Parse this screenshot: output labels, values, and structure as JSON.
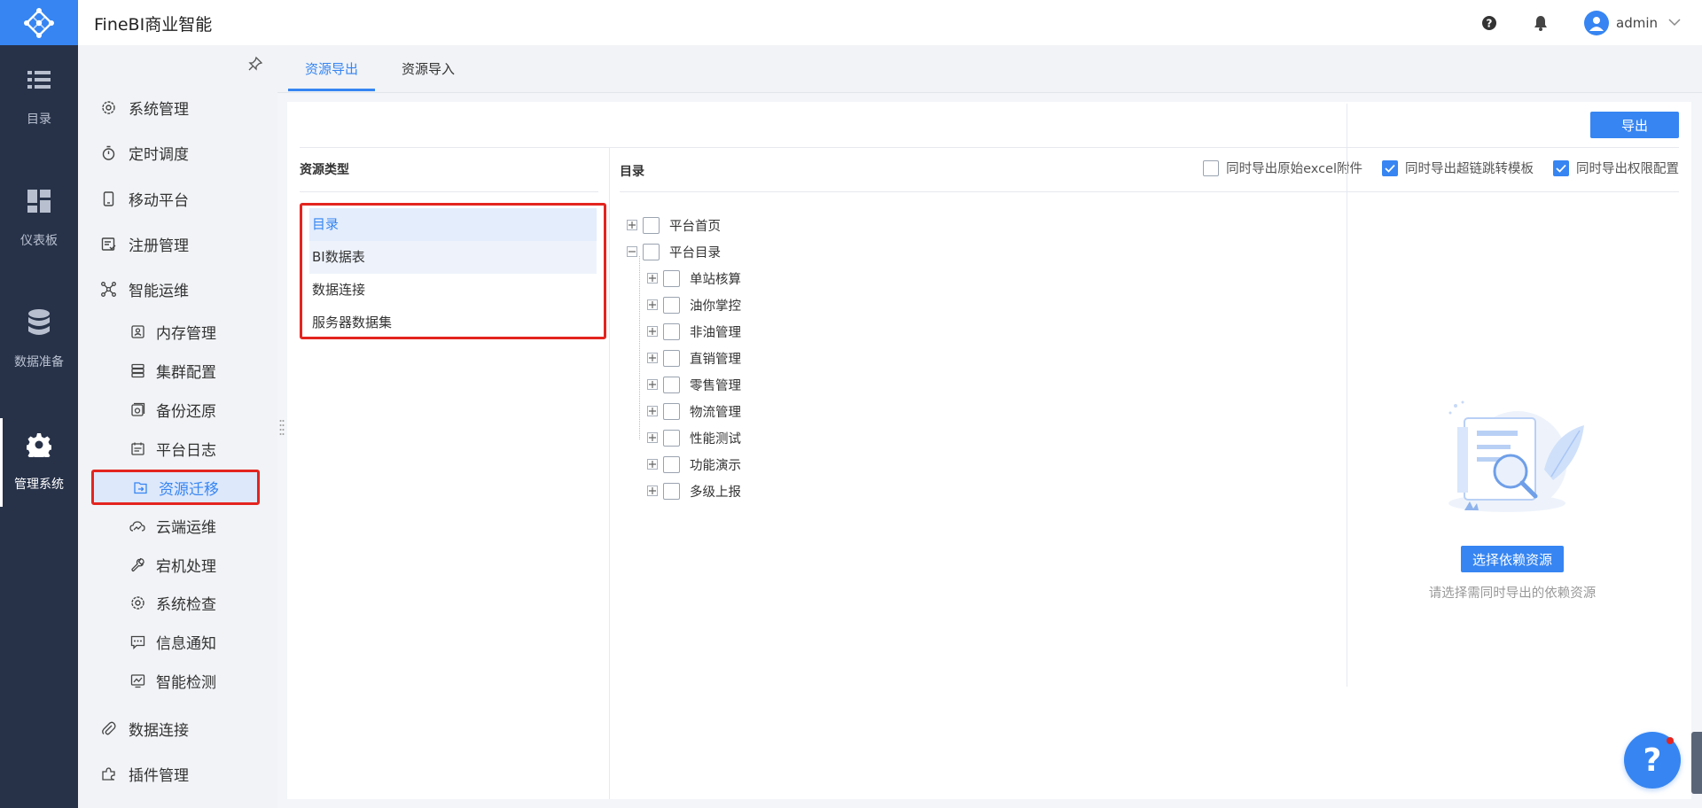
{
  "app": {
    "title": "FineBI商业智能",
    "user": "admin"
  },
  "colors": {
    "accent": "#3685f2",
    "rail_bg": "#273249",
    "highlight_border": "#e4241f"
  },
  "rail": {
    "logo_icon": "finebi-logo-icon",
    "items": [
      {
        "label": "目录",
        "icon": "list-icon"
      },
      {
        "label": "仪表板",
        "icon": "dashboard-icon"
      },
      {
        "label": "数据准备",
        "icon": "database-icon"
      },
      {
        "label": "管理系统",
        "icon": "gear-icon"
      }
    ]
  },
  "menu": {
    "items": [
      {
        "label": "系统管理",
        "icon": "settings-icon"
      },
      {
        "label": "定时调度",
        "icon": "timer-icon"
      },
      {
        "label": "移动平台",
        "icon": "mobile-icon"
      },
      {
        "label": "注册管理",
        "icon": "register-icon"
      },
      {
        "label": "智能运维",
        "icon": "network-icon"
      }
    ],
    "sub_items": [
      {
        "label": "内存管理",
        "icon": "memory-icon"
      },
      {
        "label": "集群配置",
        "icon": "cluster-icon"
      },
      {
        "label": "备份还原",
        "icon": "backup-icon"
      },
      {
        "label": "平台日志",
        "icon": "log-icon"
      },
      {
        "label": "资源迁移",
        "icon": "migrate-icon"
      },
      {
        "label": "云端运维",
        "icon": "cloud-ops-icon"
      },
      {
        "label": "宕机处理",
        "icon": "wrench-icon"
      },
      {
        "label": "系统检查",
        "icon": "check-icon"
      },
      {
        "label": "信息通知",
        "icon": "message-icon"
      },
      {
        "label": "智能检测",
        "icon": "monitor-icon"
      }
    ],
    "bottom_items": [
      {
        "label": "数据连接",
        "icon": "paperclip-icon"
      },
      {
        "label": "插件管理",
        "icon": "plugin-icon"
      }
    ]
  },
  "tabs": [
    {
      "label": "资源导出",
      "active": true
    },
    {
      "label": "资源导入",
      "active": false
    }
  ],
  "toolbar": {
    "export_label": "导出"
  },
  "resource_types": {
    "title": "资源类型",
    "items": [
      "目录",
      "BI数据表",
      "数据连接",
      "服务器数据集"
    ]
  },
  "directory": {
    "title": "目录",
    "options": [
      {
        "label": "同时导出原始excel附件",
        "checked": false
      },
      {
        "label": "同时导出超链跳转模板",
        "checked": true
      },
      {
        "label": "同时导出权限配置",
        "checked": true
      }
    ],
    "tree": [
      {
        "label": "平台首页",
        "expanded": false,
        "level": 0
      },
      {
        "label": "平台目录",
        "expanded": true,
        "level": 0
      },
      {
        "label": "单站核算",
        "expanded": false,
        "level": 1
      },
      {
        "label": "油你掌控",
        "expanded": false,
        "level": 1
      },
      {
        "label": "非油管理",
        "expanded": false,
        "level": 1
      },
      {
        "label": "直销管理",
        "expanded": false,
        "level": 1
      },
      {
        "label": "零售管理",
        "expanded": false,
        "level": 1
      },
      {
        "label": "物流管理",
        "expanded": false,
        "level": 1
      },
      {
        "label": "性能测试",
        "expanded": false,
        "level": 1
      },
      {
        "label": "功能演示",
        "expanded": false,
        "level": 1
      },
      {
        "label": "多级上报",
        "expanded": false,
        "level": 1
      }
    ]
  },
  "dependency": {
    "button_label": "选择依赖资源",
    "hint": "请选择需同时导出的依赖资源"
  }
}
